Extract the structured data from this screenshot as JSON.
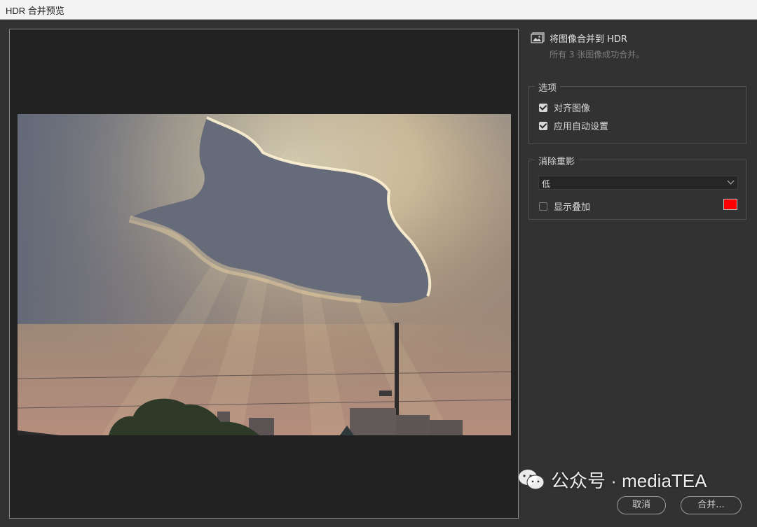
{
  "window": {
    "title": "HDR 合并预览"
  },
  "info": {
    "title": "将图像合并到 HDR",
    "subtitle": "所有 3 张图像成功合并。"
  },
  "options": {
    "legend": "选项",
    "align_images": {
      "label": "对齐图像",
      "checked": true
    },
    "auto_settings": {
      "label": "应用自动设置",
      "checked": true
    }
  },
  "ghost_removal": {
    "legend": "消除重影",
    "level": "低",
    "show_overlay": {
      "label": "显示叠加",
      "checked": false
    },
    "overlay_color": "#ff0000"
  },
  "buttons": {
    "cancel": "取消",
    "merge": "合并..."
  },
  "watermark": {
    "text": "公众号 · mediaTEA"
  }
}
